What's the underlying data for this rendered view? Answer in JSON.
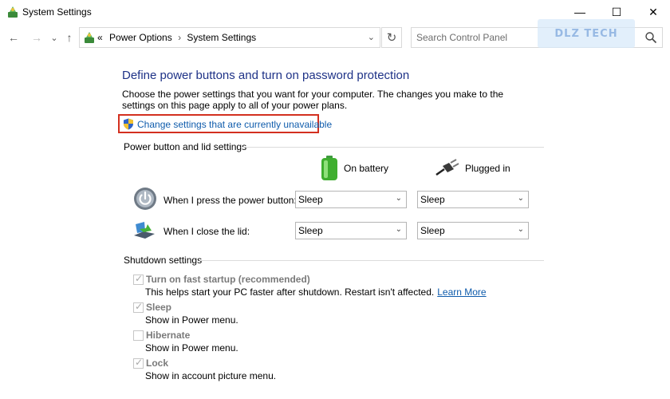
{
  "window": {
    "title": "System Settings",
    "minimize_glyph": "—",
    "maximize_glyph": "☐",
    "close_glyph": "✕"
  },
  "nav": {
    "back_glyph": "←",
    "forward_glyph": "→",
    "recent_glyph": "⌄",
    "up_glyph": "↑",
    "breadcrumb_prefix": "«",
    "breadcrumb": [
      "Power Options",
      "System Settings"
    ],
    "breadcrumb_sep": "›",
    "dropdown_glyph": "⌄",
    "refresh_glyph": "↻",
    "search_placeholder": "Search Control Panel"
  },
  "watermark": {
    "text": "DLZ TECH"
  },
  "content": {
    "heading": "Define power buttons and turn on password protection",
    "description": "Choose the power settings that you want for your computer. The changes you make to the settings on this page apply to all of your power plans.",
    "change_link": "Change settings that are currently unavailable",
    "highlight_color": "#d3301f"
  },
  "power_section": {
    "title": "Power button and lid settings",
    "columns": [
      "On battery",
      "Plugged in"
    ],
    "rows": [
      {
        "label": "When I press the power button:",
        "on_battery": "Sleep",
        "plugged_in": "Sleep",
        "icon": "power-button-icon"
      },
      {
        "label": "When I close the lid:",
        "on_battery": "Sleep",
        "plugged_in": "Sleep",
        "icon": "laptop-lid-icon"
      }
    ]
  },
  "shutdown_section": {
    "title": "Shutdown settings",
    "options": [
      {
        "label": "Turn on fast startup (recommended)",
        "desc": "This helps start your PC faster after shutdown. Restart isn't affected.",
        "link": "Learn More",
        "checked": true
      },
      {
        "label": "Sleep",
        "desc": "Show in Power menu.",
        "checked": true
      },
      {
        "label": "Hibernate",
        "desc": "Show in Power menu.",
        "checked": false
      },
      {
        "label": "Lock",
        "desc": "Show in account picture menu.",
        "checked": true
      }
    ]
  },
  "colors": {
    "heading": "#1e3287",
    "link": "#0f5cac",
    "disabled_text": "#7a7a7a"
  }
}
